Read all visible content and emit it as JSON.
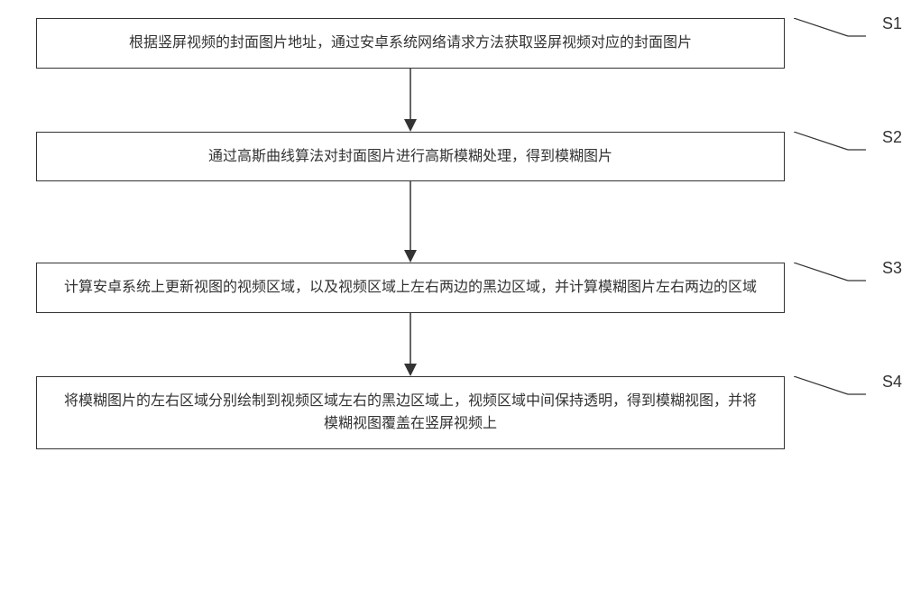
{
  "chart_data": {
    "type": "flowchart",
    "direction": "top-to-bottom",
    "steps": [
      {
        "id": "S1",
        "text": "根据竖屏视频的封面图片地址，通过安卓系统网络请求方法获取竖屏视频对应的封面图片"
      },
      {
        "id": "S2",
        "text": "通过高斯曲线算法对封面图片进行高斯模糊处理，得到模糊图片"
      },
      {
        "id": "S3",
        "text": "计算安卓系统上更新视图的视频区域，以及视频区域上左右两边的黑边区域，并计算模糊图片左右两边的区域"
      },
      {
        "id": "S4",
        "text": "将模糊图片的左右区域分别绘制到视频区域左右的黑边区域上，视频区域中间保持透明，得到模糊视图，并将模糊视图覆盖在竖屏视频上"
      }
    ],
    "arrow_between_steps": true
  }
}
